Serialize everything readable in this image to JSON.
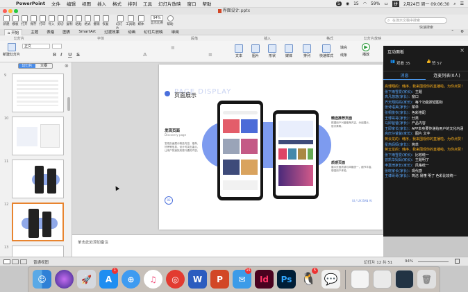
{
  "menubar": {
    "app_name": "PowerPoint",
    "items": [
      "文件",
      "编辑",
      "视图",
      "插入",
      "格式",
      "排列",
      "工具",
      "幻灯片放映",
      "窗口",
      "帮助"
    ],
    "status": {
      "badge_count": "5",
      "bubble_count": "15",
      "battery": "59%",
      "clock": "2月24日 周一 09:06:30"
    }
  },
  "window": {
    "title": "界面设计.pptx"
  },
  "toolbar": {
    "buttons": [
      "新建",
      "模板",
      "打开",
      "保存",
      "打印",
      "导入",
      "剪切",
      "复制",
      "粘贴",
      "格式",
      "撤销",
      "恢复",
      "幻灯片",
      "工具箱",
      "媒体"
    ],
    "zoom_value": "94%",
    "zoom_label": "显示比例",
    "help_label": "帮助",
    "search_placeholder": "在演示文稿中搜索",
    "fast_search": "快速搜索"
  },
  "ribbon": {
    "tabs": [
      "开始",
      "主题",
      "表格",
      "图表",
      "SmartArt",
      "过渡效果",
      "动画",
      "幻灯片放映",
      "审阅"
    ],
    "groups": [
      "幻灯片",
      "字体",
      "段落",
      "插入",
      "格式",
      "幻灯片放映"
    ],
    "new_slide": "新建幻灯片",
    "font_name": "正文",
    "insert_items": [
      "文本",
      "图片",
      "形状",
      "媒体"
    ],
    "format_items": [
      "排列",
      "快速样式"
    ],
    "slideshow_item": "播放",
    "fill_label": "填充",
    "line_label": "线条"
  },
  "slides_panel": {
    "tabs": [
      "幻灯片",
      "大纲"
    ],
    "active_tab": "幻灯片",
    "numbers": [
      "9",
      "10",
      "11",
      "12",
      "13"
    ]
  },
  "slide": {
    "heading": "页面展示",
    "bg_text": "PAGE DISPLAY",
    "section1_title": "发现页面",
    "section1_sub": "Discovery page",
    "section1_body": "发现页面展示精选内容，推荐、热榜等信息，设计时突出重点，让用户快速找到感兴趣的内容。",
    "section2_title": "精选推荐页面",
    "section2_body": "根据用户兴趣推荐内容，分组展示，层次清晰。",
    "section3_title": "质感页面",
    "section3_body": "展示页面质感与风格统一，细节丰富，增强用户体验。",
    "page_num": "03",
    "footer": "UI / UX BAN AI"
  },
  "notes": {
    "placeholder": "单击此处添加备注"
  },
  "statusbar": {
    "view_label": "普通视图",
    "slide_counter": "幻灯片 12 共 51",
    "zoom": "94%"
  },
  "interaction_panel": {
    "title": "互动面板",
    "viewers": "观看 35",
    "likes": "赞 57",
    "tabs": [
      "消息",
      "连麦列表(0人)"
    ],
    "active_tab": "消息",
    "messages": [
      {
        "user": "高博翔的：韩序，",
        "text": "我来围观你的直播啦，为你点赞！",
        "highlight": true
      },
      {
        "user": "张下雨雪爱(家长)：",
        "text": "主题",
        "highlight": false
      },
      {
        "user": "高凡悠悠(家长)：",
        "text": "窗口",
        "highlight": false
      },
      {
        "user": "齐天翔妈妈(家长)：",
        "text": "每个功能按钮图标",
        "highlight": false
      },
      {
        "user": "张诗语美(家长)：",
        "text": "菜单",
        "highlight": false
      },
      {
        "user": "张桐俊衣(家长)：",
        "text": "色彩搭配",
        "highlight": false
      },
      {
        "user": "王博哥哥(家长)：",
        "text": "分类",
        "highlight": false
      },
      {
        "user": "马即爸爸(家长)：",
        "text": "产品内容",
        "highlight": false
      },
      {
        "user": "王即家长(家长)：",
        "text": "APP本身要传递给用户的文化内涵",
        "highlight": false
      },
      {
        "user": "高庆仔爸爸(家长)：",
        "text": "图片 文字",
        "highlight": false
      },
      {
        "user": "蒋云龙的：韩序，",
        "text": "我来围观你的直播啦，为你点赞！",
        "highlight": true
      },
      {
        "user": "星热妈妈(家长)：",
        "text": "简单",
        "highlight": false
      },
      {
        "user": "蒋云龙的：韩序，",
        "text": "我来围观你的直播啦，为你点赞！",
        "highlight": true
      },
      {
        "user": "张下雨雪爱(家长)：",
        "text": "比较统一",
        "highlight": false
      },
      {
        "user": "曾凯华妈妈(家长)：",
        "text": "主题明了",
        "highlight": false
      },
      {
        "user": "申嘉琦家长(家长)：",
        "text": "风格统一",
        "highlight": false
      },
      {
        "user": "张晓家长(家长)：",
        "text": "现代感",
        "highlight": false
      },
      {
        "user": "王博哥哥(家长)：",
        "text": "简洁 易懂 明了 色彩比较统一",
        "highlight": false
      }
    ]
  },
  "dock": {
    "badges": {
      "appstore": "1",
      "qq_mail": "15",
      "qq": "5"
    }
  }
}
